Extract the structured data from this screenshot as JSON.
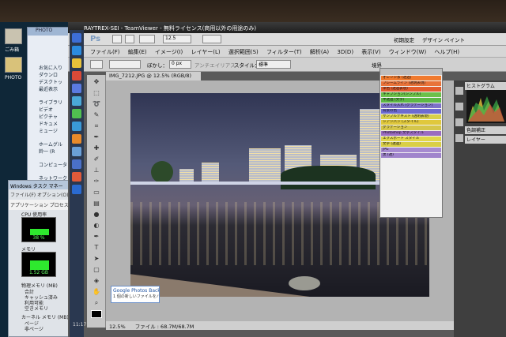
{
  "desktop": {
    "icons": [
      {
        "label": "ごみ箱",
        "icon": "recycle-bin-icon"
      },
      {
        "label": "PHOTO",
        "icon": "folder-icon"
      }
    ]
  },
  "explorer": {
    "title": "PHOTO",
    "nav": [
      "お気に入り",
      "ダウンロ",
      "デスクトッ",
      "最近表示",
      "ライブラリ",
      "ビデオ",
      "ピクチャ",
      "ドキュメ",
      "ミュージ",
      "ホームグル",
      "鈴一 (R",
      "コンピュータ",
      "ネットワーク"
    ]
  },
  "taskmgr": {
    "title": "Windows タスク マネー",
    "menu": "ファイル(F)  オプション(O)",
    "tabs": "アプリケーション プロセス",
    "cpu_label": "CPU 使用率",
    "cpu_value": "38 %",
    "cpu_level": 0.38,
    "mem_label": "メモリ",
    "mem_value": "1.52 GB",
    "mem_level": 0.55,
    "phys_label": "物理メモリ (MB)",
    "phys_rows": [
      "合計",
      "キャッシュ済み",
      "利用可能",
      "空きメモリ"
    ],
    "kernel_label": "カーネル メモリ (MB)",
    "kernel_rows": [
      "ページ",
      "非ページ"
    ]
  },
  "ps": {
    "window_title": "RAYTREX-SEI - TeamViewer - 無料ライセンス(商用以外の用途のみ)",
    "logo": "Ps",
    "zoom_select": "12.5",
    "essentials": "初期設定",
    "design": "デザイン",
    "paint": "ペイント",
    "menu": [
      "ファイル(F)",
      "編集(E)",
      "イメージ(I)",
      "レイヤー(L)",
      "選択範囲(S)",
      "フィルター(T)",
      "解析(A)",
      "3D(D)",
      "表示(V)",
      "ウィンドウ(W)",
      "ヘルプ(H)"
    ],
    "opt_feather_label": "ぼかし：",
    "opt_feather_value": "0 px",
    "opt_antialias": "アンチエイリアス",
    "opt_style_label": "スタイル：",
    "opt_style_value": "標準",
    "opt_refine": "境界",
    "doc_tab": "IMG_7212.JPG @ 12.5% (RGB/8)",
    "status_zoom": "12.5%",
    "status_file": "ファイル : 68.7M/68.7M",
    "histogram_tab": "ヒストグラム",
    "color_tab": "色調補正",
    "layer_tab": "レイヤー",
    "clock": "11:17",
    "google_photos": "Google Photos Backup",
    "google_photos_sub": "1 個の新しいファイルをバックアップしています"
  },
  "styles": [
    {
      "label": "オレンジ系 (透過)",
      "color": "#f07a2e"
    },
    {
      "label": "フレームライン (透明表現)",
      "color": "#e8733a"
    },
    {
      "label": "単色 (透過表現)",
      "color": "#e25b2c"
    },
    {
      "label": "キャプション(シンプル)",
      "color": "#6cc04a"
    },
    {
      "label": "半透過 (文字)",
      "color": "#5cb845"
    },
    {
      "label": "スタイル入れ (グラデーション)",
      "color": "#7d72c8"
    },
    {
      "label": "背景の色",
      "color": "#6d6bd0"
    },
    {
      "label": "サンプルテキスト (透明表現)",
      "color": "#d8d04a"
    },
    {
      "label": "シアンパン (スタイル)",
      "color": "#e0c83c"
    },
    {
      "label": "グラデーション",
      "color": "#d5c64a"
    },
    {
      "label": "Photoshop 文字スタイル",
      "color": "#9a6cc0"
    },
    {
      "label": "エクスポート スタイル",
      "color": "#e0d64a"
    },
    {
      "label": "文字 (透過)",
      "color": "#d9cf46"
    },
    {
      "label": "JPG",
      "color": "#a68ad0"
    },
    {
      "label": "黒 (透)",
      "color": "#a084cc"
    }
  ]
}
